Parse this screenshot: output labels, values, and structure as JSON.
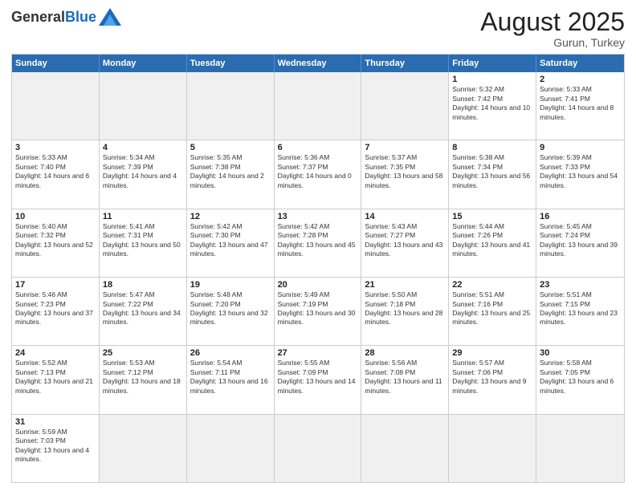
{
  "header": {
    "logo_general": "General",
    "logo_blue": "Blue",
    "month_year": "August 2025",
    "location": "Gurun, Turkey"
  },
  "weekdays": [
    "Sunday",
    "Monday",
    "Tuesday",
    "Wednesday",
    "Thursday",
    "Friday",
    "Saturday"
  ],
  "rows": [
    [
      {
        "day": "",
        "info": "",
        "empty": true
      },
      {
        "day": "",
        "info": "",
        "empty": true
      },
      {
        "day": "",
        "info": "",
        "empty": true
      },
      {
        "day": "",
        "info": "",
        "empty": true
      },
      {
        "day": "",
        "info": "",
        "empty": true
      },
      {
        "day": "1",
        "info": "Sunrise: 5:32 AM\nSunset: 7:42 PM\nDaylight: 14 hours and 10 minutes.",
        "empty": false
      },
      {
        "day": "2",
        "info": "Sunrise: 5:33 AM\nSunset: 7:41 PM\nDaylight: 14 hours and 8 minutes.",
        "empty": false
      }
    ],
    [
      {
        "day": "3",
        "info": "Sunrise: 5:33 AM\nSunset: 7:40 PM\nDaylight: 14 hours and 6 minutes.",
        "empty": false
      },
      {
        "day": "4",
        "info": "Sunrise: 5:34 AM\nSunset: 7:39 PM\nDaylight: 14 hours and 4 minutes.",
        "empty": false
      },
      {
        "day": "5",
        "info": "Sunrise: 5:35 AM\nSunset: 7:38 PM\nDaylight: 14 hours and 2 minutes.",
        "empty": false
      },
      {
        "day": "6",
        "info": "Sunrise: 5:36 AM\nSunset: 7:37 PM\nDaylight: 14 hours and 0 minutes.",
        "empty": false
      },
      {
        "day": "7",
        "info": "Sunrise: 5:37 AM\nSunset: 7:35 PM\nDaylight: 13 hours and 58 minutes.",
        "empty": false
      },
      {
        "day": "8",
        "info": "Sunrise: 5:38 AM\nSunset: 7:34 PM\nDaylight: 13 hours and 56 minutes.",
        "empty": false
      },
      {
        "day": "9",
        "info": "Sunrise: 5:39 AM\nSunset: 7:33 PM\nDaylight: 13 hours and 54 minutes.",
        "empty": false
      }
    ],
    [
      {
        "day": "10",
        "info": "Sunrise: 5:40 AM\nSunset: 7:32 PM\nDaylight: 13 hours and 52 minutes.",
        "empty": false
      },
      {
        "day": "11",
        "info": "Sunrise: 5:41 AM\nSunset: 7:31 PM\nDaylight: 13 hours and 50 minutes.",
        "empty": false
      },
      {
        "day": "12",
        "info": "Sunrise: 5:42 AM\nSunset: 7:30 PM\nDaylight: 13 hours and 47 minutes.",
        "empty": false
      },
      {
        "day": "13",
        "info": "Sunrise: 5:42 AM\nSunset: 7:28 PM\nDaylight: 13 hours and 45 minutes.",
        "empty": false
      },
      {
        "day": "14",
        "info": "Sunrise: 5:43 AM\nSunset: 7:27 PM\nDaylight: 13 hours and 43 minutes.",
        "empty": false
      },
      {
        "day": "15",
        "info": "Sunrise: 5:44 AM\nSunset: 7:26 PM\nDaylight: 13 hours and 41 minutes.",
        "empty": false
      },
      {
        "day": "16",
        "info": "Sunrise: 5:45 AM\nSunset: 7:24 PM\nDaylight: 13 hours and 39 minutes.",
        "empty": false
      }
    ],
    [
      {
        "day": "17",
        "info": "Sunrise: 5:46 AM\nSunset: 7:23 PM\nDaylight: 13 hours and 37 minutes.",
        "empty": false
      },
      {
        "day": "18",
        "info": "Sunrise: 5:47 AM\nSunset: 7:22 PM\nDaylight: 13 hours and 34 minutes.",
        "empty": false
      },
      {
        "day": "19",
        "info": "Sunrise: 5:48 AM\nSunset: 7:20 PM\nDaylight: 13 hours and 32 minutes.",
        "empty": false
      },
      {
        "day": "20",
        "info": "Sunrise: 5:49 AM\nSunset: 7:19 PM\nDaylight: 13 hours and 30 minutes.",
        "empty": false
      },
      {
        "day": "21",
        "info": "Sunrise: 5:50 AM\nSunset: 7:18 PM\nDaylight: 13 hours and 28 minutes.",
        "empty": false
      },
      {
        "day": "22",
        "info": "Sunrise: 5:51 AM\nSunset: 7:16 PM\nDaylight: 13 hours and 25 minutes.",
        "empty": false
      },
      {
        "day": "23",
        "info": "Sunrise: 5:51 AM\nSunset: 7:15 PM\nDaylight: 13 hours and 23 minutes.",
        "empty": false
      }
    ],
    [
      {
        "day": "24",
        "info": "Sunrise: 5:52 AM\nSunset: 7:13 PM\nDaylight: 13 hours and 21 minutes.",
        "empty": false
      },
      {
        "day": "25",
        "info": "Sunrise: 5:53 AM\nSunset: 7:12 PM\nDaylight: 13 hours and 18 minutes.",
        "empty": false
      },
      {
        "day": "26",
        "info": "Sunrise: 5:54 AM\nSunset: 7:11 PM\nDaylight: 13 hours and 16 minutes.",
        "empty": false
      },
      {
        "day": "27",
        "info": "Sunrise: 5:55 AM\nSunset: 7:09 PM\nDaylight: 13 hours and 14 minutes.",
        "empty": false
      },
      {
        "day": "28",
        "info": "Sunrise: 5:56 AM\nSunset: 7:08 PM\nDaylight: 13 hours and 11 minutes.",
        "empty": false
      },
      {
        "day": "29",
        "info": "Sunrise: 5:57 AM\nSunset: 7:06 PM\nDaylight: 13 hours and 9 minutes.",
        "empty": false
      },
      {
        "day": "30",
        "info": "Sunrise: 5:58 AM\nSunset: 7:05 PM\nDaylight: 13 hours and 6 minutes.",
        "empty": false
      }
    ],
    [
      {
        "day": "31",
        "info": "Sunrise: 5:59 AM\nSunset: 7:03 PM\nDaylight: 13 hours and 4 minutes.",
        "empty": false
      },
      {
        "day": "",
        "info": "",
        "empty": true
      },
      {
        "day": "",
        "info": "",
        "empty": true
      },
      {
        "day": "",
        "info": "",
        "empty": true
      },
      {
        "day": "",
        "info": "",
        "empty": true
      },
      {
        "day": "",
        "info": "",
        "empty": true
      },
      {
        "day": "",
        "info": "",
        "empty": true
      }
    ]
  ]
}
